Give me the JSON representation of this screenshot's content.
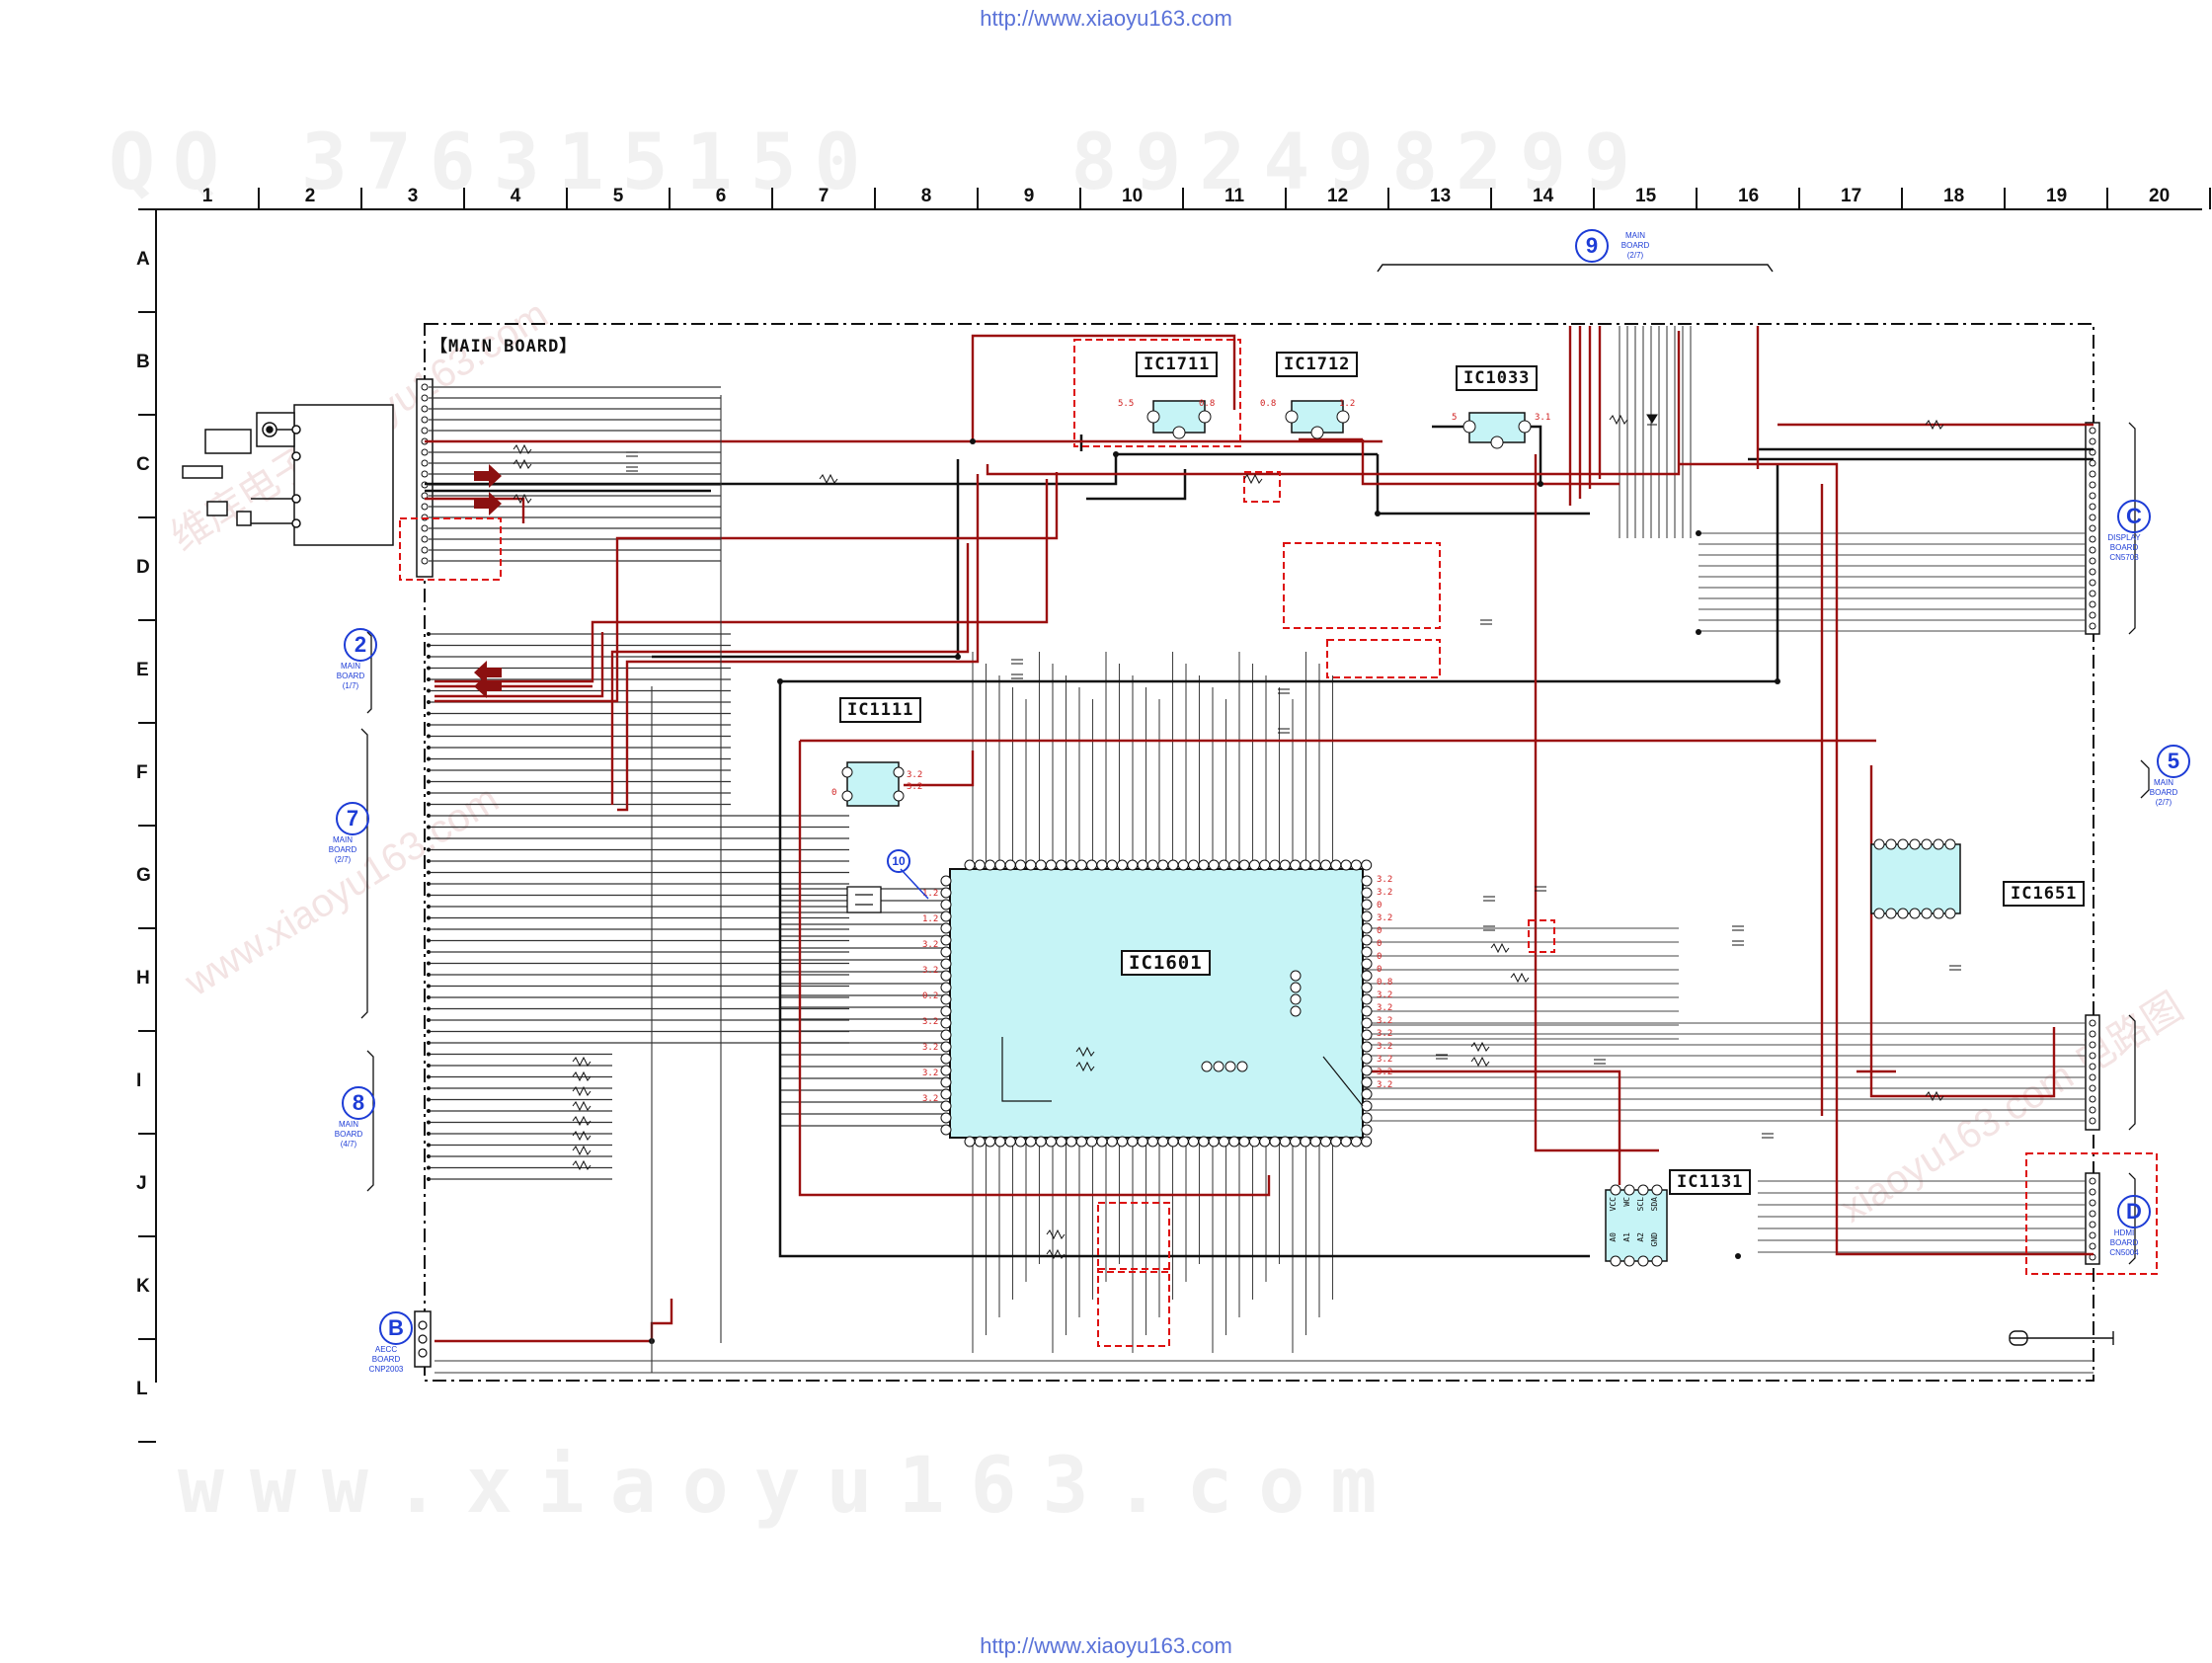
{
  "header_url": "http://www.xiaoyu163.com",
  "footer_url": "http://www.xiaoyu163.com",
  "watermark_top": "QQ 376315150   892498299",
  "watermark_bottom": "www.xiaoyu163.com",
  "watermark_diagonal": [
    "维库电子 xiaoyu163.com",
    "www.xiaoyu163.com",
    "xiaoyu163.com 电路图"
  ],
  "grid_columns": [
    "1",
    "2",
    "3",
    "4",
    "5",
    "6",
    "7",
    "8",
    "9",
    "10",
    "11",
    "12",
    "13",
    "14",
    "15",
    "16",
    "17",
    "18",
    "19",
    "20"
  ],
  "grid_rows": [
    "A",
    "B",
    "C",
    "D",
    "E",
    "F",
    "G",
    "H",
    "I",
    "J",
    "K",
    "L"
  ],
  "board_title": "【MAIN BOARD】",
  "ic_labels": {
    "ic1711": "IC1711",
    "ic1712": "IC1712",
    "ic1033": "IC1033",
    "ic1111": "IC1111",
    "ic1601": "IC1601",
    "ic1651": "IC1651",
    "ic1131": "IC1131"
  },
  "connectors": {
    "c9": {
      "symbol": "9",
      "line1": "MAIN",
      "line2": "BOARD",
      "line3": "(2/7)"
    },
    "c2": {
      "symbol": "2",
      "line1": "MAIN",
      "line2": "BOARD",
      "line3": "(1/7)"
    },
    "c7": {
      "symbol": "7",
      "line1": "MAIN",
      "line2": "BOARD",
      "line3": "(2/7)"
    },
    "c8": {
      "symbol": "8",
      "line1": "MAIN",
      "line2": "BOARD",
      "line3": "(4/7)"
    },
    "cB": {
      "symbol": "B",
      "line1": "AECC",
      "line2": "BOARD",
      "line3": "CNP2003"
    },
    "cC": {
      "symbol": "C",
      "line1": "DISPLAY",
      "line2": "BOARD",
      "line3": "CN5703"
    },
    "c5": {
      "symbol": "5",
      "line1": "MAIN",
      "line2": "BOARD",
      "line3": "(2/7)"
    },
    "cD": {
      "symbol": "D",
      "line1": "HDMI",
      "line2": "BOARD",
      "line3": "CN5004"
    }
  },
  "callout_10": "10",
  "ic1131_pins": [
    "VCC",
    "WC",
    "SCL",
    "SDA",
    "A0",
    "A1",
    "A2",
    "GND"
  ],
  "voltages_ic1711": [
    "5.5",
    "0.8"
  ],
  "voltages_ic1712": [
    "0.8",
    "1.2"
  ],
  "voltages_ic1033": [
    "5",
    "3.1"
  ],
  "voltages_ic1111": [
    "0",
    "3.2",
    "3.2"
  ],
  "voltages_ic1601_right": [
    "3.2",
    "3.2",
    "0",
    "3.2",
    "0",
    "0",
    "0",
    "0",
    "0.8",
    "3.2",
    "3.2",
    "3.2",
    "3.2",
    "3.2",
    "3.2",
    "3.2",
    "3.2"
  ],
  "voltages_ic1601_left": [
    "1.2",
    "1.2",
    "3.2",
    "3.2",
    "0.2",
    "3.2",
    "3.2",
    "3.2",
    "3.2"
  ],
  "colors": {
    "signal_red": "#9b1010",
    "wire_black": "#1a1a1a",
    "ic_fill": "#c6f4f6",
    "connector_blue": "#1d3cd6",
    "dashed_red": "#dd1111",
    "watermark": "#f1f1f1"
  }
}
